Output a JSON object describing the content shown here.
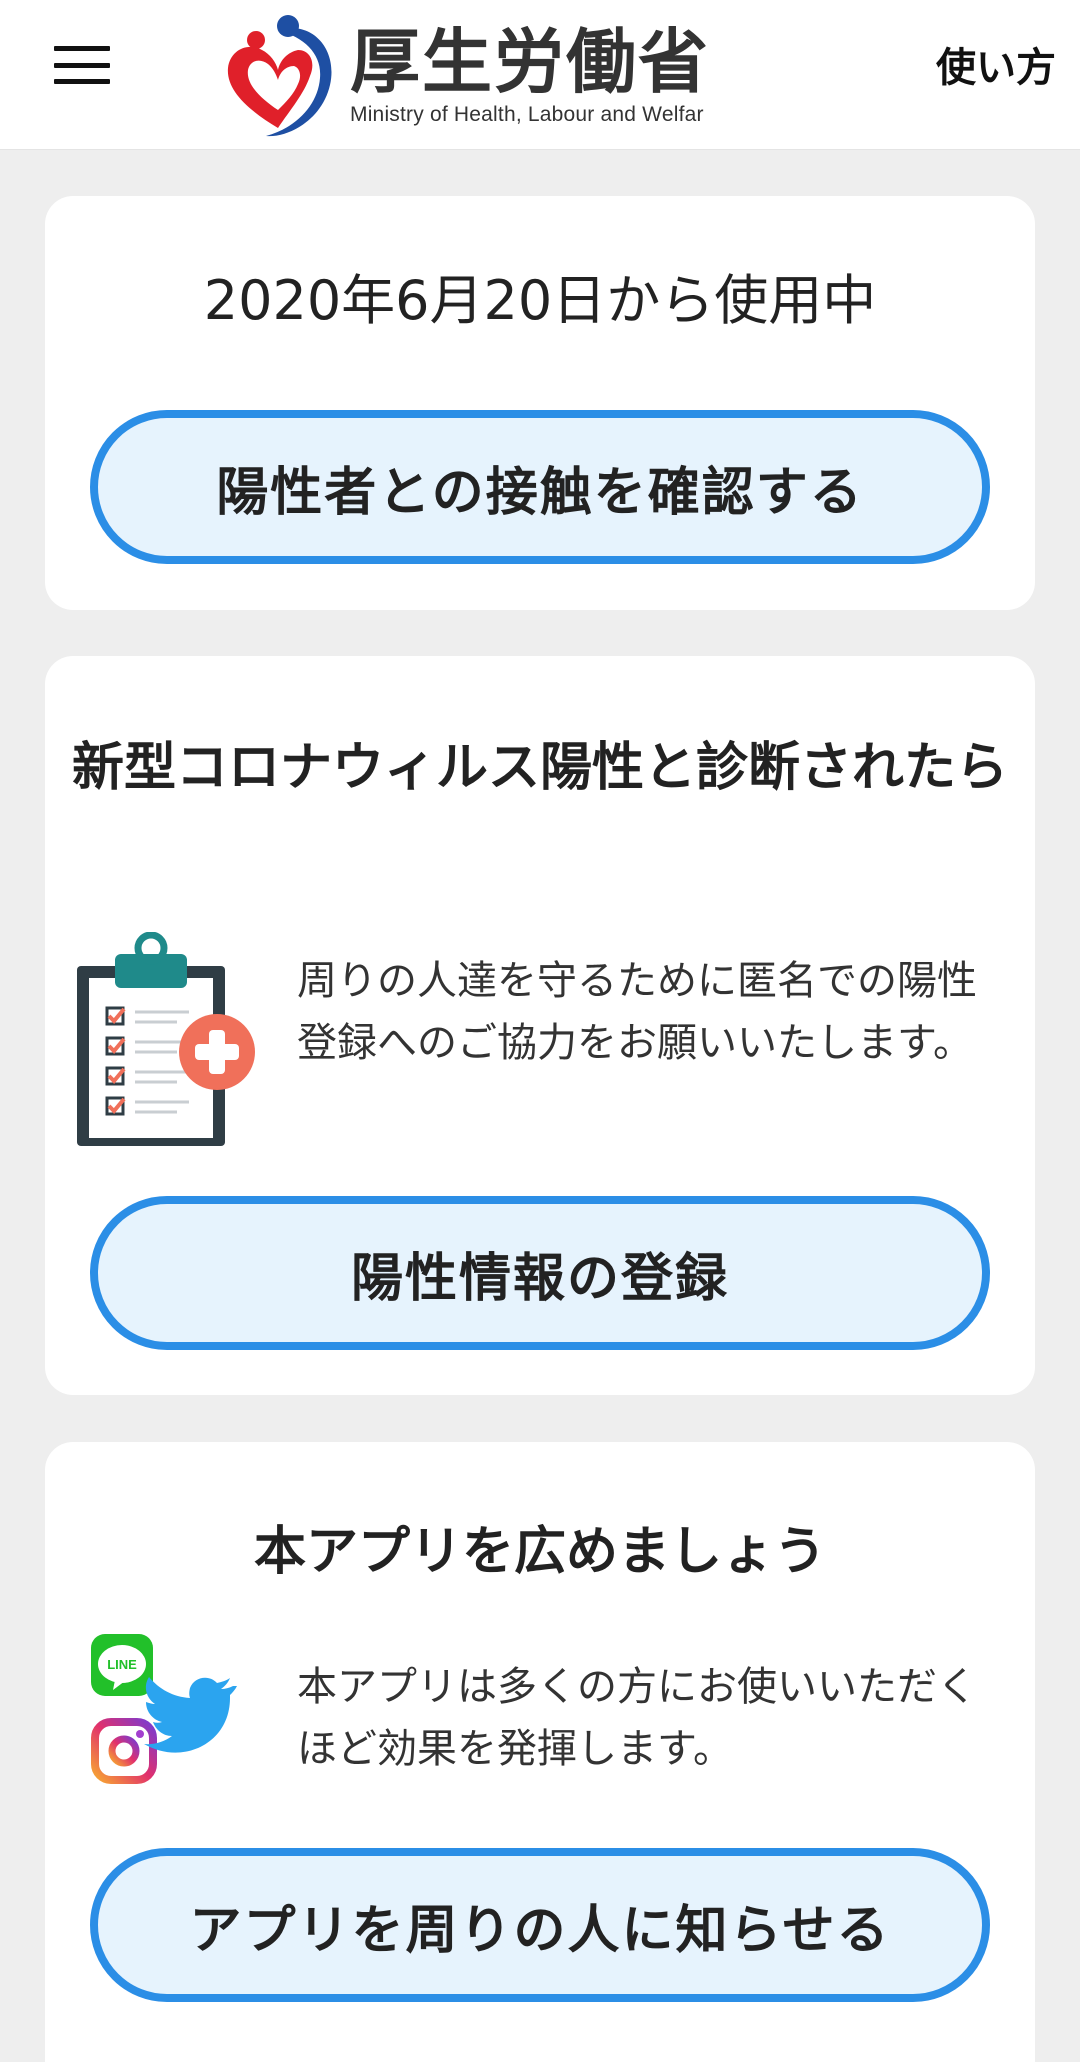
{
  "header": {
    "logo_title": "厚生労働省",
    "logo_subtitle": "Ministry of Health, Labour and Welfar",
    "howto_label": "使い方"
  },
  "status_card": {
    "since_text": "2020年6月20日から使用中",
    "check_button": "陽性者との接触を確認する"
  },
  "positive_card": {
    "title": "新型コロナウィルス陽性と診断されたら",
    "description": "周りの人達を守るために匿名での陽性登録へのご協力をお願いいたします。",
    "register_button": "陽性情報の登録"
  },
  "share_card": {
    "title": "本アプリを広めましょう",
    "description": "本アプリは多くの方にお使いいただくほど効果を発揮します。",
    "share_button": "アプリを周りの人に知らせる",
    "line_label": "LINE"
  },
  "colors": {
    "button_border": "#2b8ee6",
    "button_fill": "#e6f3fd",
    "background": "#eeeeee",
    "line_green": "#22c02a",
    "twitter_blue": "#2ba4ef",
    "plus_orange": "#f0705a",
    "clipboard_teal": "#1f8a8a"
  },
  "icons": [
    "menu-icon",
    "mhlw-logo",
    "clipboard-plus-icon",
    "line-icon",
    "twitter-icon",
    "instagram-icon"
  ]
}
